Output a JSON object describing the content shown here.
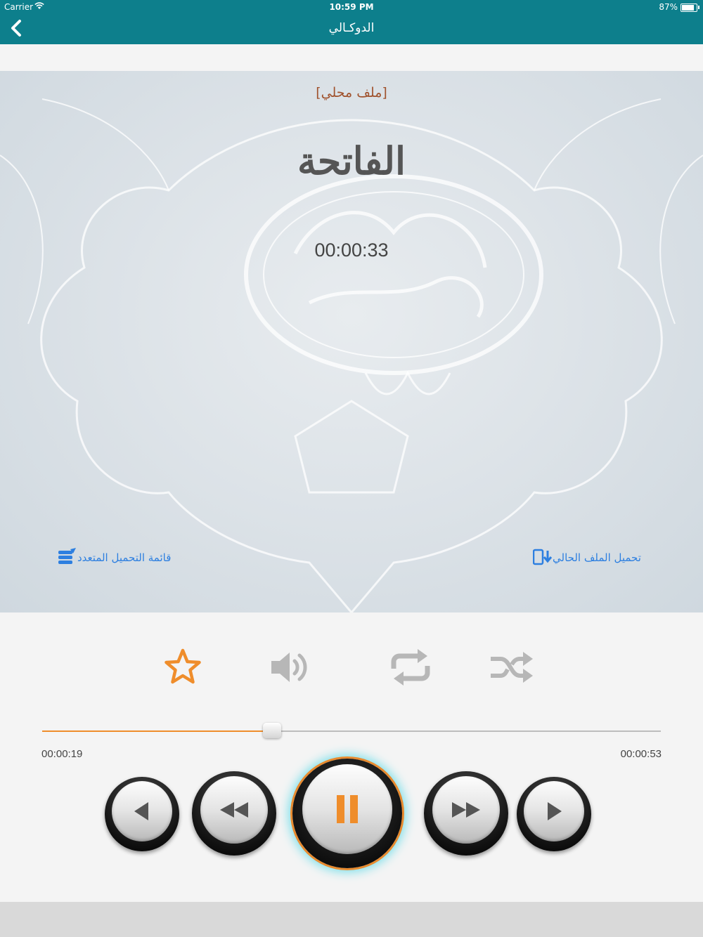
{
  "status_bar": {
    "carrier": "Carrier",
    "time": "10:59 PM",
    "battery": "87%"
  },
  "nav": {
    "title": "الدوكـالي",
    "back_icon": "chevron-left-icon"
  },
  "hero": {
    "source_label": "[ملف محلي]",
    "surah_name": "الفاتحة",
    "elapsed": "00:00:33",
    "download_current_label": "تحميل الملف الحالي",
    "download_list_label": "قائمة التحميل المتعدد"
  },
  "toolbar": {
    "favorite_icon": "star-icon",
    "volume_icon": "volume-icon",
    "repeat_icon": "repeat-icon",
    "shuffle_icon": "shuffle-icon",
    "favorite_color": "#ef8d2b",
    "icon_color": "#b7b7b7"
  },
  "progress": {
    "fraction": 0.372,
    "current": "00:00:19",
    "total": "00:00:53",
    "fill_color": "#ef8d2b"
  },
  "playback": {
    "previous_icon": "previous-track-icon",
    "rewind_icon": "rewind-icon",
    "pause_icon": "pause-icon",
    "forward_icon": "fast-forward-icon",
    "next_icon": "next-track-icon",
    "accent": "#ef8d2b"
  },
  "colors": {
    "nav_bar": "#0d7f8c",
    "link": "#2d7fe0",
    "source_label": "#a0522d"
  }
}
